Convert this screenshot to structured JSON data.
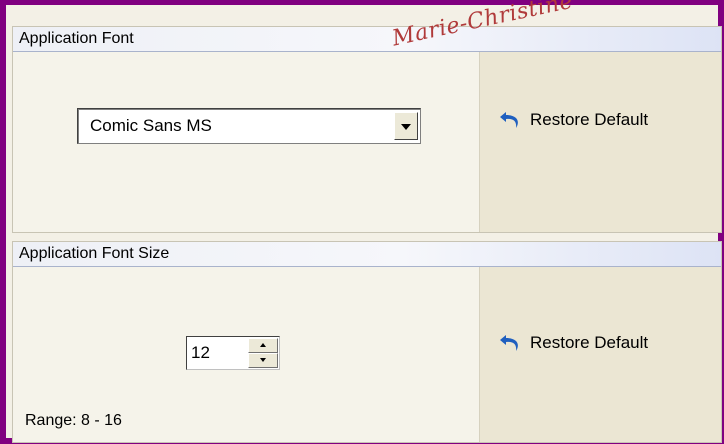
{
  "sections": {
    "font": {
      "title": "Application Font",
      "selected_font": "Comic Sans MS",
      "restore_label": "Restore Default"
    },
    "size": {
      "title": "Application Font Size",
      "value": "12",
      "range_label": "Range: 8 - 16",
      "restore_label": "Restore Default"
    }
  },
  "watermark": "Marie-Christine",
  "colors": {
    "frame_border": "#800080",
    "header_gradient_end": "#dde3f5",
    "right_panel": "#ebe6d3",
    "restore_icon": "#1f5fbf",
    "watermark": "#b03a3a"
  },
  "icons": {
    "dropdown": "chevron-down-icon",
    "spin_up": "arrow-up-icon",
    "spin_down": "arrow-down-icon",
    "restore": "undo-arrow-icon"
  }
}
